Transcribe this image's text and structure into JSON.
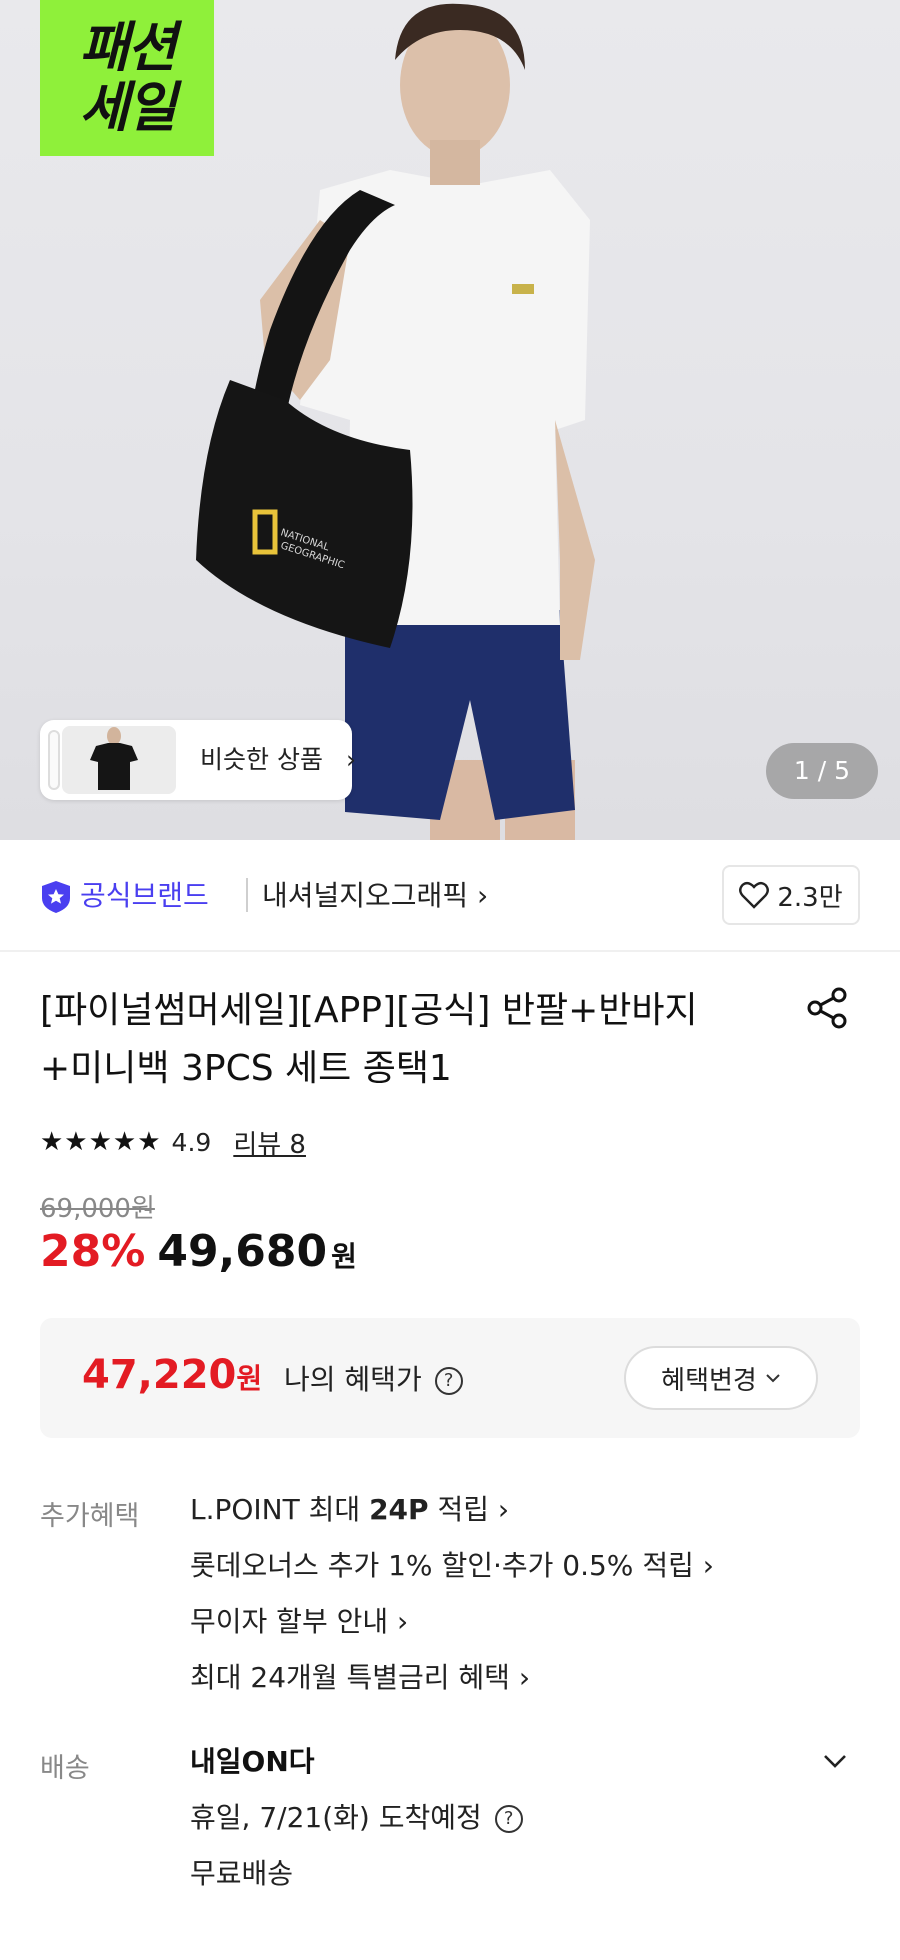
{
  "hero": {
    "promo_badge": [
      "패션",
      "세일"
    ],
    "similar": {
      "label": "비슷한 상품",
      "arrow": "›"
    },
    "counter": "1 / 5"
  },
  "brand": {
    "official_label": "공식브랜드",
    "name": "내셔널지오그래픽 ›",
    "likes": "2.3만"
  },
  "product": {
    "title_line1": "[파이널썸머세일][APP][공식] 반팔+반바지",
    "title_line2": "+미니백 3PCS 세트 종택1",
    "stars": "★★★★★",
    "rating": "4.9",
    "review_link": "리뷰 8",
    "original_price": "69,000원",
    "discount": "28%",
    "sale_price": "49,680",
    "won": "원"
  },
  "benefit": {
    "price": "47,220",
    "won": "원",
    "label": "나의 혜택가",
    "help": "?",
    "change_button": "혜택변경"
  },
  "extra": {
    "label": "추가혜택",
    "items": [
      {
        "pre": "L.POINT 최대 ",
        "bold": "24P",
        "post": " 적립 ›"
      },
      {
        "pre": "롯데오너스 추가 1% 할인·추가 0.5% 적립 ›",
        "bold": "",
        "post": ""
      },
      {
        "pre": "무이자 할부 안내 ›",
        "bold": "",
        "post": ""
      },
      {
        "pre": "최대 24개월 특별금리 혜택 ›",
        "bold": "",
        "post": ""
      }
    ]
  },
  "shipping": {
    "label": "배송",
    "title": "내일ON다",
    "arrival": "휴일, 7/21(화) 도착예정",
    "help": "?",
    "fee": "무료배송"
  },
  "colors": {
    "accent": "#4a3ff0",
    "sale_red": "#e31b23",
    "promo_green": "#8ff03a"
  }
}
